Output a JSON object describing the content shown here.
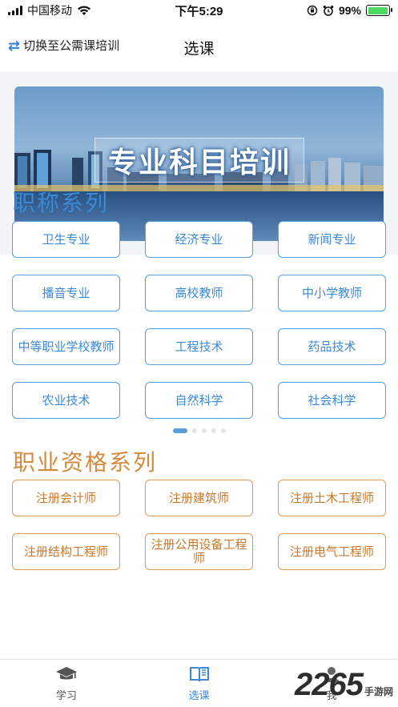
{
  "status_bar": {
    "carrier": "中国移动",
    "time": "下午5:29",
    "battery": "99%",
    "battery_level": 0.99
  },
  "nav": {
    "switch_label": "切换至公需课培训",
    "title": "选课"
  },
  "banner": {
    "title": "专业科目培训"
  },
  "section_titles": {
    "title_series": "职称系列",
    "qualification_series": "职业资格系列"
  },
  "title_series_items": [
    {
      "label": "卫生专业"
    },
    {
      "label": "经济专业"
    },
    {
      "label": "新闻专业"
    },
    {
      "label": "播音专业"
    },
    {
      "label": "高校教师"
    },
    {
      "label": "中小学教师"
    },
    {
      "label": "中等职业学校教师"
    },
    {
      "label": "工程技术"
    },
    {
      "label": "药品技术"
    },
    {
      "label": "农业技术"
    },
    {
      "label": "自然科学"
    },
    {
      "label": "社会科学"
    }
  ],
  "qualification_items": [
    {
      "label": "注册会计师"
    },
    {
      "label": "注册建筑师"
    },
    {
      "label": "注册土木工程师"
    },
    {
      "label": "注册结构工程师"
    },
    {
      "label": "注册公用设备工程师"
    },
    {
      "label": "注册电气工程师"
    }
  ],
  "carousel": {
    "page_count": 5,
    "active_index": 0
  },
  "tabs": [
    {
      "label": "学习",
      "icon": "graduation-cap-icon"
    },
    {
      "label": "选课",
      "icon": "book-icon"
    },
    {
      "label": "我",
      "icon": "person-icon"
    }
  ],
  "watermark": {
    "number": "2265",
    "text": "手游网"
  },
  "colors": {
    "blue_accent": "#3c8ad6",
    "orange_accent": "#d38a3c",
    "battery_green": "#4cd964"
  }
}
